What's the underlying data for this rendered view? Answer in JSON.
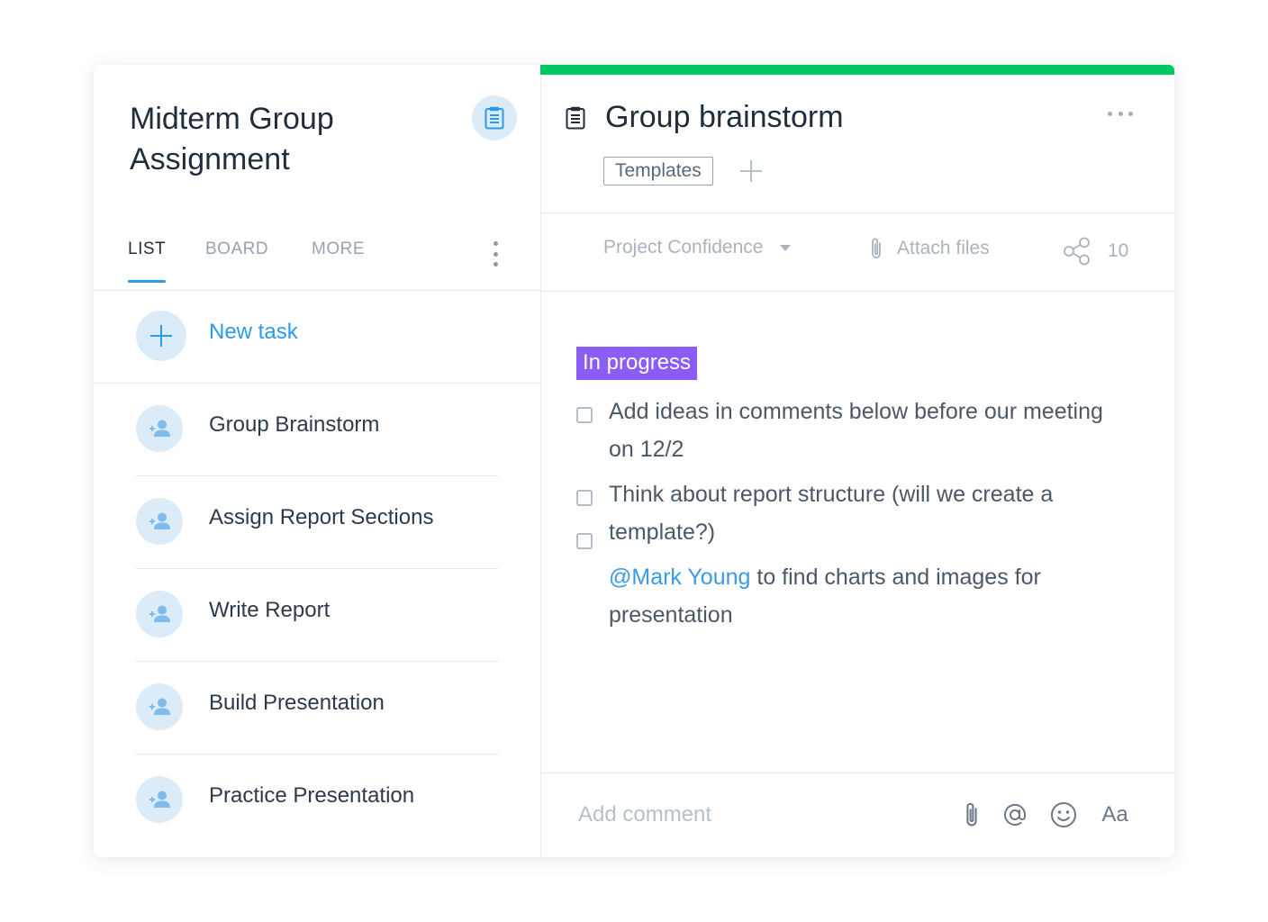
{
  "colors": {
    "accent": "#2a9aea",
    "progress_bar": "#00c862",
    "status_badge": "#8b5cf6",
    "icon_circle_bg": "#dcebf8"
  },
  "project": {
    "title": "Midterm Group Assignment",
    "icon": "clipboard-icon"
  },
  "tabs": [
    {
      "label": "LIST",
      "active": true
    },
    {
      "label": "BOARD",
      "active": false
    },
    {
      "label": "MORE",
      "active": false
    }
  ],
  "new_task": {
    "label": "New task",
    "icon": "plus-icon"
  },
  "tasks": [
    {
      "name": "Group Brainstorm",
      "icon": "assign-user-icon"
    },
    {
      "name": "Assign Report Sections",
      "icon": "assign-user-icon"
    },
    {
      "name": "Write Report",
      "icon": "assign-user-icon"
    },
    {
      "name": "Build Presentation",
      "icon": "assign-user-icon"
    },
    {
      "name": "Practice Presentation",
      "icon": "assign-user-icon"
    }
  ],
  "detail": {
    "title": "Group brainstorm",
    "icon": "clipboard-icon",
    "tag": "Templates",
    "toolbar": {
      "confidence_label": "Project Confidence",
      "attach_label": "Attach files",
      "share_count": "10"
    },
    "status": "In progress",
    "checklist": [
      {
        "text": "Add ideas in comments below before our meeting on 12/2",
        "checked": false
      },
      {
        "text": "Think about report structure (will we create a template?)",
        "checked": false
      },
      {
        "mention": "@Mark Young",
        "text": " to find charts and images for presentation",
        "checked": false
      }
    ]
  },
  "comment": {
    "placeholder": "Add comment",
    "format_label": "Aa"
  }
}
